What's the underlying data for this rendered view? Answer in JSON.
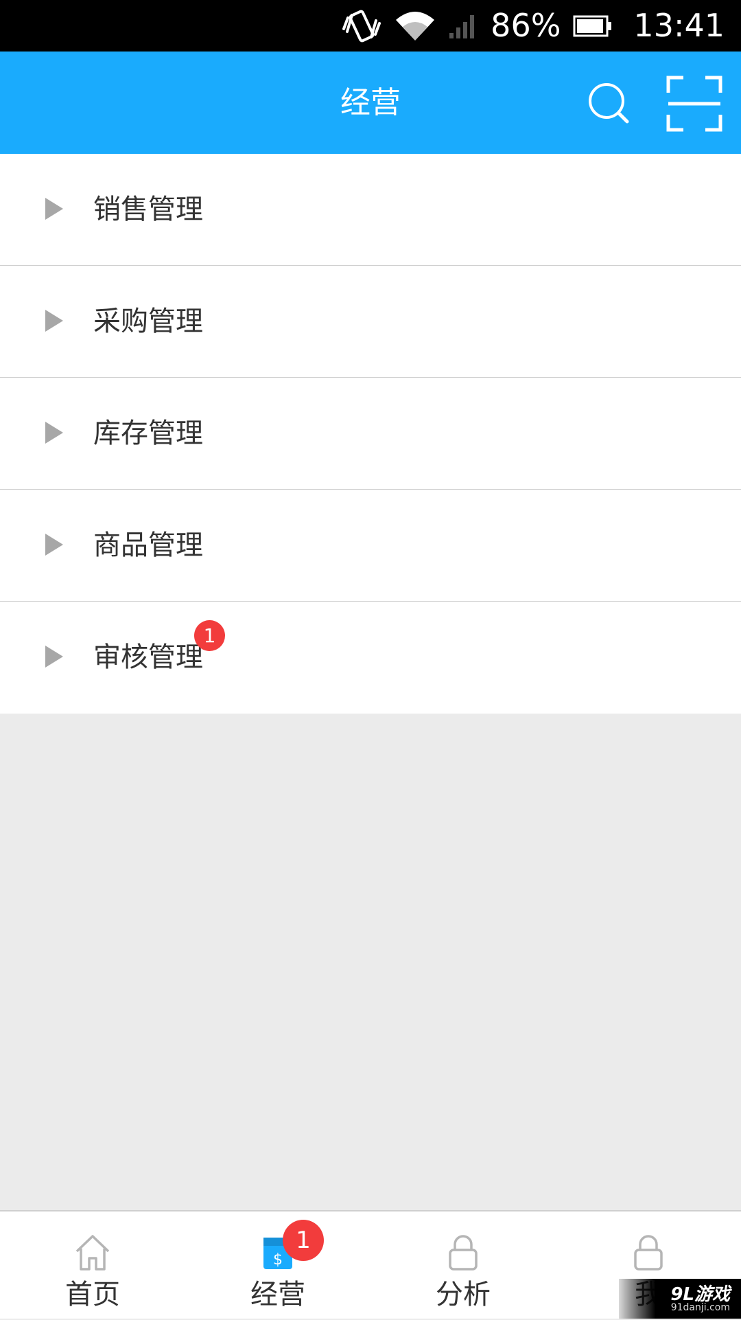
{
  "status_bar": {
    "battery_percent": "86%",
    "time": "13:41",
    "icons": [
      "vibrate-icon",
      "wifi-icon",
      "signal-icon",
      "battery-icon"
    ]
  },
  "header": {
    "title": "经营",
    "search_icon": "search-icon",
    "scan_icon": "scan-icon",
    "background_color": "#1aabfd"
  },
  "menu": {
    "items": [
      {
        "label": "销售管理",
        "badge": ""
      },
      {
        "label": "采购管理",
        "badge": ""
      },
      {
        "label": "库存管理",
        "badge": ""
      },
      {
        "label": "商品管理",
        "badge": ""
      },
      {
        "label": "审核管理",
        "badge": "1"
      }
    ]
  },
  "bottom_nav": {
    "items": [
      {
        "label": "首页",
        "icon": "home-icon",
        "badge": ""
      },
      {
        "label": "经营",
        "icon": "business-icon",
        "badge": "1",
        "active": true
      },
      {
        "label": "分析",
        "icon": "lock-icon",
        "badge": ""
      },
      {
        "label": "我",
        "icon": "lock-icon",
        "badge": ""
      }
    ]
  },
  "watermark": {
    "main": "9L游戏",
    "sub": "91danji.com"
  },
  "colors": {
    "accent": "#1aabfd",
    "badge": "#f23c3c",
    "background": "#ebebeb"
  }
}
